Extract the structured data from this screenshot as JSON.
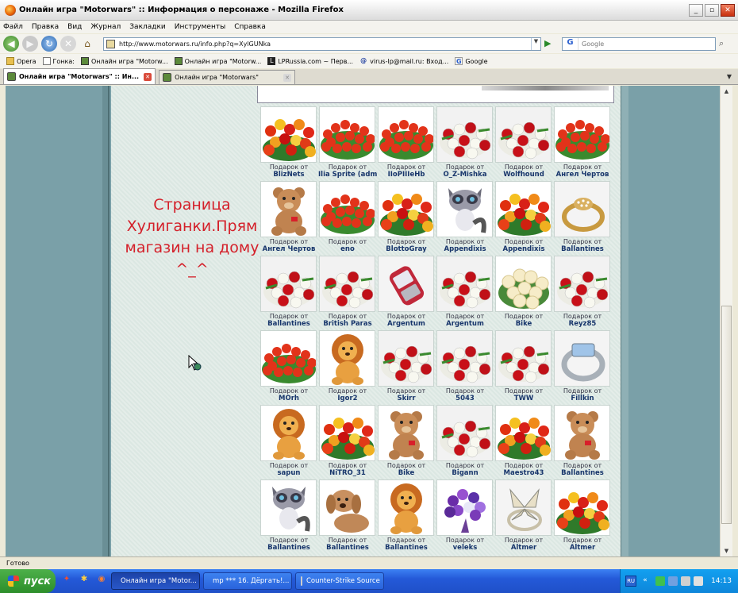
{
  "window": {
    "title": "Онлайн игра \"Motorwars\" :: Информация о персонаже - Mozilla Firefox"
  },
  "menu": [
    "Файл",
    "Правка",
    "Вид",
    "Журнал",
    "Закладки",
    "Инструменты",
    "Справка"
  ],
  "address": {
    "url": "http://www.motorwars.ru/info.php?q=XylGUNka"
  },
  "search": {
    "engine": "G",
    "placeholder": "Google"
  },
  "bookmarks": [
    {
      "label": "Opera",
      "icon": "folder-icon"
    },
    {
      "label": "Гонка:",
      "icon": "page-icon"
    },
    {
      "label": "Онлайн игра \"Motorw...",
      "icon": "motorwars-icon"
    },
    {
      "label": "Онлайн игра \"Motorw...",
      "icon": "motorwars-icon"
    },
    {
      "label": "LPRussia.com ~ Перв...",
      "icon": "lp-icon"
    },
    {
      "label": "virus-lp@mail.ru: Вход...",
      "icon": "mail-icon"
    },
    {
      "label": "Google",
      "icon": "google-icon"
    }
  ],
  "tabs": [
    {
      "label": "Онлайн игра \"Motorwars\" :: Ин...",
      "active": true
    },
    {
      "label": "Онлайн игра \"Motorwars\"",
      "active": false
    }
  ],
  "page": {
    "banner_text": "Страница Хулиганки.Прям магазин на дому ^_^",
    "gift_prefix": "Подарок от",
    "gifts": [
      {
        "from": "BlizNets",
        "item": "flowers-mixed"
      },
      {
        "from": "Ilia Sprite (adm)",
        "item": "flowers-red"
      },
      {
        "from": "IIoPIIIeHb",
        "item": "flowers-red"
      },
      {
        "from": "O_Z-Mishka",
        "item": "flowers-roses-white"
      },
      {
        "from": "Wolfhound",
        "item": "flowers-roses-white"
      },
      {
        "from": "Ангел Чертов",
        "item": "flowers-red"
      },
      {
        "from": "Ангел Чертов",
        "item": "teddy-bear"
      },
      {
        "from": "eno",
        "item": "flowers-red"
      },
      {
        "from": "BlottoGray",
        "item": "flowers-mixed"
      },
      {
        "from": "Appendixis",
        "item": "toy-raccoon"
      },
      {
        "from": "Appendixis",
        "item": "flowers-mixed"
      },
      {
        "from": "Ballantines",
        "item": "gold-ring"
      },
      {
        "from": "Ballantines",
        "item": "flowers-roses-white"
      },
      {
        "from": "British Paras",
        "item": "flowers-roses-white"
      },
      {
        "from": "Argentum",
        "item": "phone"
      },
      {
        "from": "Argentum",
        "item": "flowers-roses-white"
      },
      {
        "from": "Bike",
        "item": "flowers-cream"
      },
      {
        "from": "Reyz85",
        "item": "flowers-roses-white"
      },
      {
        "from": "MOrh",
        "item": "flowers-red"
      },
      {
        "from": "Igor2",
        "item": "toy-lion"
      },
      {
        "from": "Skirr",
        "item": "flowers-roses-white"
      },
      {
        "from": "5043",
        "item": "flowers-roses-white"
      },
      {
        "from": "TWW",
        "item": "flowers-roses-white"
      },
      {
        "from": "Fillkin",
        "item": "silver-ring"
      },
      {
        "from": "sapun",
        "item": "toy-lion"
      },
      {
        "from": "NiTRO_31",
        "item": "flowers-mixed"
      },
      {
        "from": "Bike",
        "item": "teddy-bear"
      },
      {
        "from": "Bigann",
        "item": "flowers-roses-white"
      },
      {
        "from": "Maestro43",
        "item": "flowers-mixed"
      },
      {
        "from": "Ballantines",
        "item": "teddy-bear"
      },
      {
        "from": "Ballantines",
        "item": "toy-raccoon"
      },
      {
        "from": "Ballantines",
        "item": "toy-dog"
      },
      {
        "from": "Ballantines",
        "item": "toy-lion"
      },
      {
        "from": "veleks",
        "item": "flowers-violet"
      },
      {
        "from": "Altmer",
        "item": "butterfly-ring"
      },
      {
        "from": "Altmer",
        "item": "flowers-mixed"
      }
    ]
  },
  "status": {
    "text": "Готово"
  },
  "taskbar": {
    "start_label": "пуск",
    "tasks": [
      {
        "label": "Онлайн игра \"Motor...",
        "active": true,
        "icon_color": "#e06a10"
      },
      {
        "label": "mp *** 16. Дёргать!...",
        "active": false,
        "icon_color": "#e0a020"
      },
      {
        "label": "Counter-Strike Source",
        "active": false,
        "icon_color": "#333333"
      }
    ],
    "lang": "RU",
    "clock": "14:13"
  }
}
